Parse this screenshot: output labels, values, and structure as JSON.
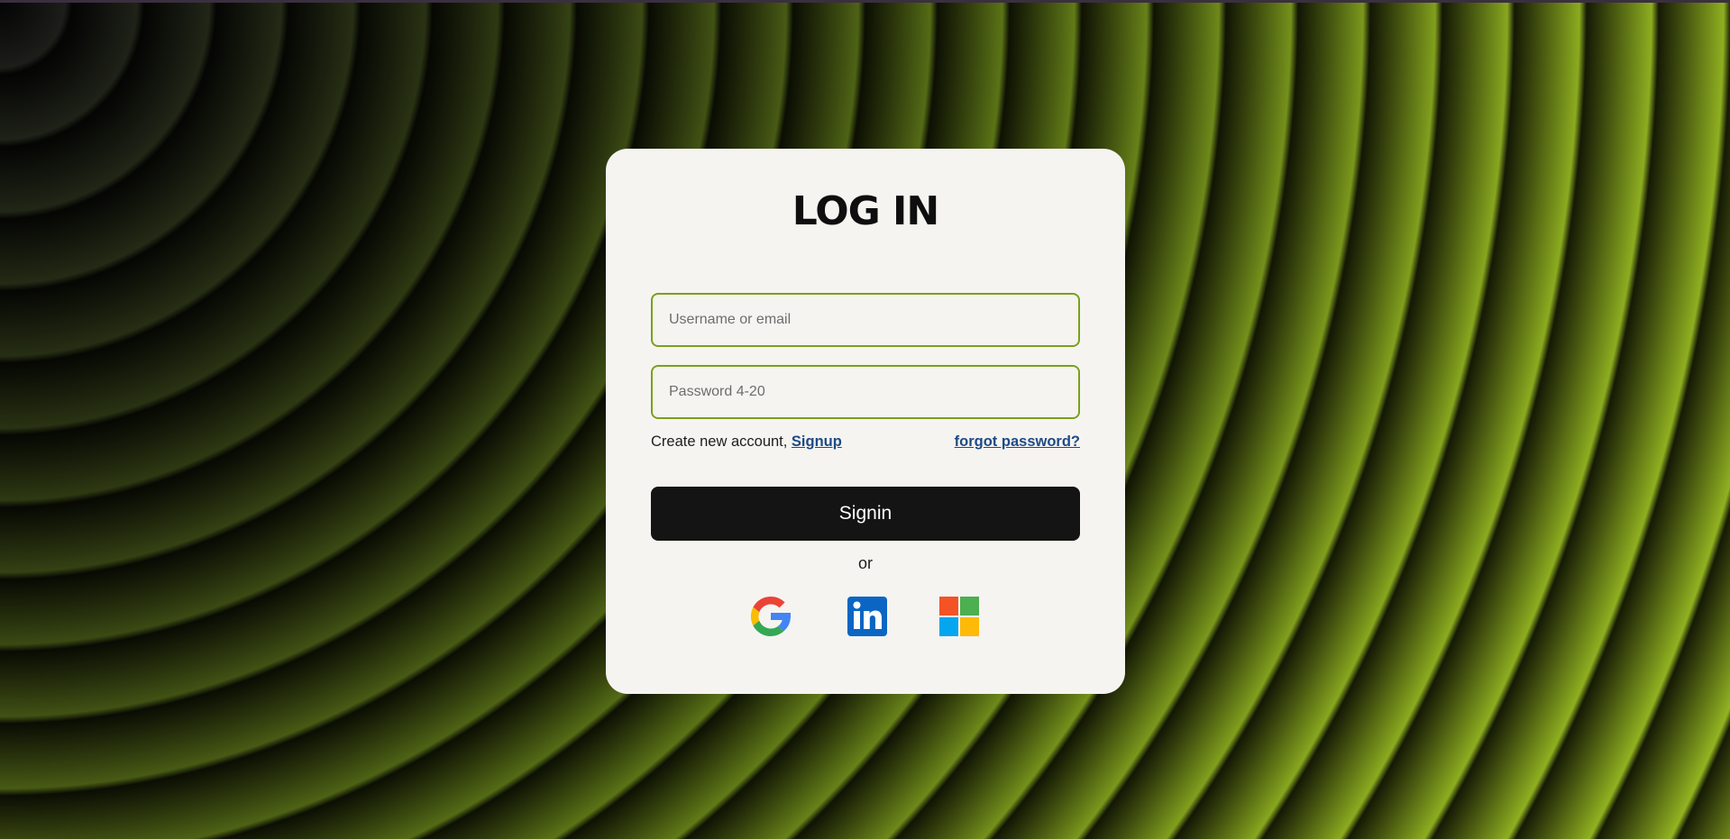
{
  "page": {
    "title": "LOG IN"
  },
  "form": {
    "username_placeholder": "Username or email",
    "password_placeholder": "Password 4-20",
    "create_account_text": "Create new account, ",
    "signup_link": "Signup",
    "forgot_password_link": "forgot password?",
    "signin_button": "Signin",
    "or_text": "or"
  },
  "social": {
    "providers": [
      {
        "name": "Google",
        "icon": "google-icon"
      },
      {
        "name": "LinkedIn",
        "icon": "linkedin-icon"
      },
      {
        "name": "Microsoft",
        "icon": "microsoft-icon"
      }
    ]
  },
  "colors": {
    "accent": "#7aa11c",
    "link": "#1f4a86",
    "button_bg": "#141414",
    "card_bg": "#f5f4f1"
  }
}
